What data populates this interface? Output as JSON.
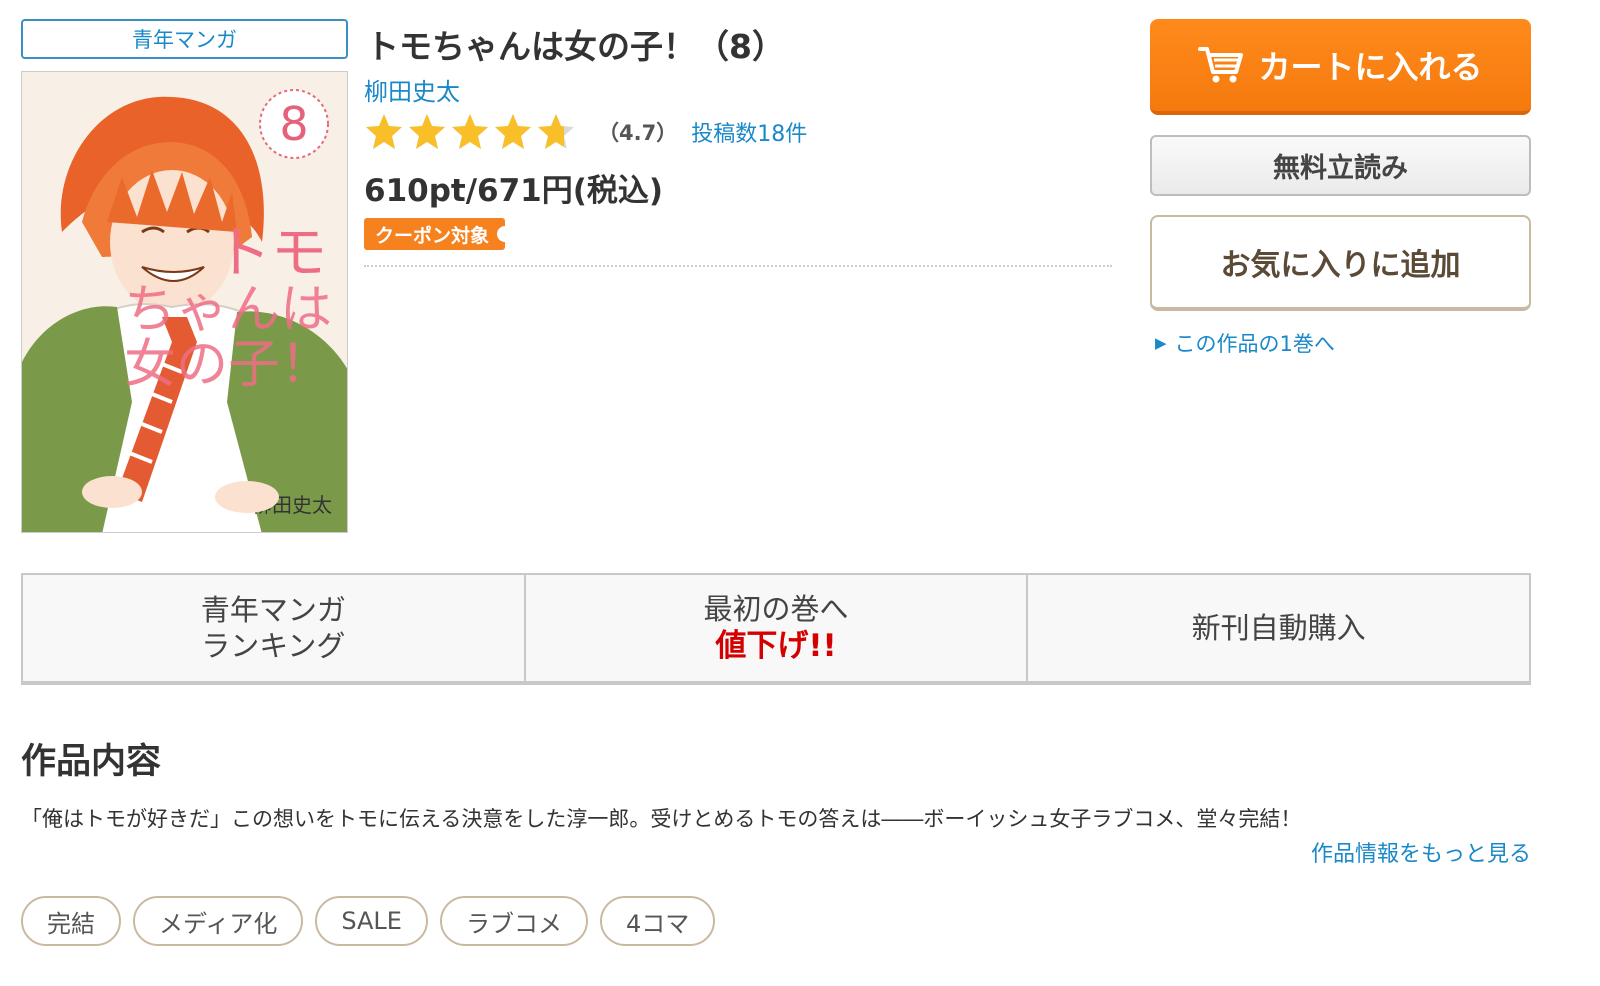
{
  "product": {
    "category": "青年マンガ",
    "title": "トモちゃんは女の子！（8）",
    "author": "柳田史太",
    "rating": {
      "value": 4.7,
      "value_text": "（4.7）",
      "review_count_text": "投稿数18件",
      "star_color": "#f9bf28",
      "star_empty_color": "#d9d9d9"
    },
    "price": "610pt/671円(税込)",
    "coupon_label": "クーポン対象",
    "cover": {
      "volume_number": "8",
      "title_text_line1": "トモ",
      "title_text_line2": "ちゃんは",
      "title_text_line3": "女の子！",
      "author_text": "柳田史太"
    }
  },
  "actions": {
    "cart_label": "カートに入れる",
    "trial_label": "無料立読み",
    "favorite_label": "お気に入りに追加",
    "first_volume_link": "この作品の1巻へ"
  },
  "tabs": [
    {
      "line1": "青年マンガ",
      "line2": "ランキング",
      "line2_style": "normal"
    },
    {
      "line1": "最初の巻へ",
      "line2": "値下げ!!",
      "line2_style": "red"
    },
    {
      "line1": "新刊自動購入",
      "line2": "",
      "line2_style": "normal"
    }
  ],
  "description": {
    "heading": "作品内容",
    "text": "「俺はトモが好きだ」この想いをトモに伝える決意をした淳一郎。受けとめるトモの答えは――ボーイッシュ女子ラブコメ、堂々完結！",
    "more_link": "作品情報をもっと見る"
  },
  "tags": [
    "完結",
    "メディア化",
    "SALE",
    "ラブコメ",
    "4コマ"
  ],
  "colors": {
    "accent_blue": "#1a88c9",
    "cart_orange": "#f6821f",
    "sale_red": "#d40000",
    "tag_border": "#c9b9a2"
  }
}
